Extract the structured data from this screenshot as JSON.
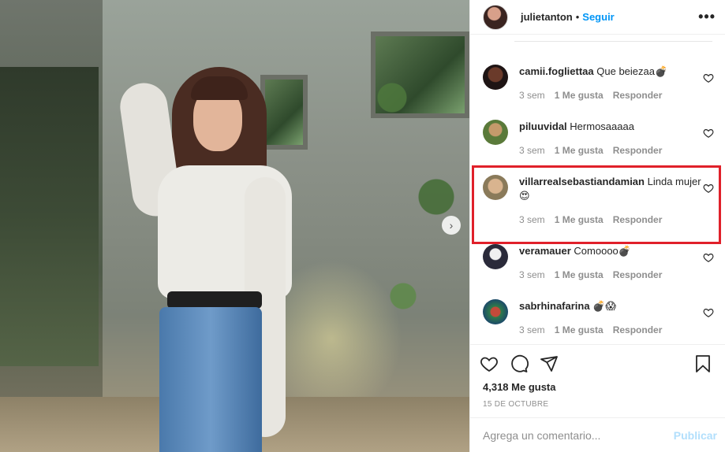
{
  "post": {
    "author": "julietanton",
    "separator": "•",
    "follow_label": "Seguir",
    "more_label": "•••",
    "next_label": "›"
  },
  "comments": [
    {
      "user": "camii.fogliettaa",
      "text": "Que beiezaa💣",
      "time": "3 sem",
      "likes": "1 Me gusta",
      "reply": "Responder"
    },
    {
      "user": "piluuvidal",
      "text": "Hermosaaaaa",
      "time": "3 sem",
      "likes": "1 Me gusta",
      "reply": "Responder"
    },
    {
      "user": "villarrealsebastiandamian",
      "text": "Linda mujer 😍",
      "time": "3 sem",
      "likes": "1 Me gusta",
      "reply": "Responder"
    },
    {
      "user": "veramauer",
      "text": "Comoooo💣",
      "time": "3 sem",
      "likes": "1 Me gusta",
      "reply": "Responder"
    },
    {
      "user": "sabrhinafarina",
      "text": "💣😱",
      "time": "3 sem",
      "likes": "1 Me gusta",
      "reply": "Responder"
    }
  ],
  "stats": {
    "likes_label": "4,318 Me gusta",
    "date": "15 DE OCTUBRE"
  },
  "composer": {
    "placeholder": "Agrega un comentario...",
    "publish_label": "Publicar"
  },
  "colors": {
    "accent": "#0095f6",
    "highlight": "#e0202a",
    "muted": "#8e8e8e",
    "publish_disabled": "#b2dffc"
  },
  "icons": [
    "heart-icon",
    "comment-icon",
    "share-icon",
    "bookmark-icon",
    "more-icon",
    "chevron-right-icon"
  ]
}
